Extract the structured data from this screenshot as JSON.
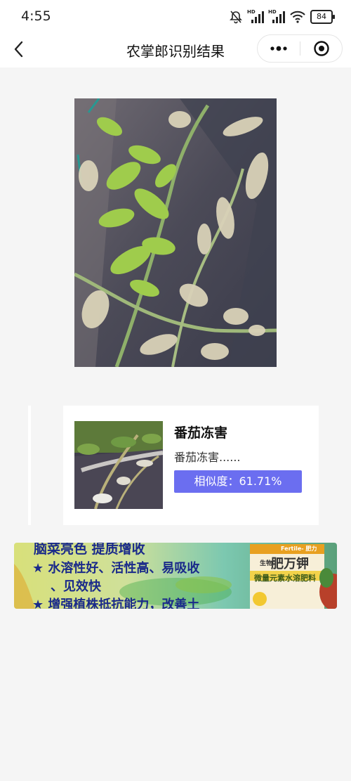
{
  "status": {
    "time": "4:55",
    "signal1_label": "HD",
    "signal2_label": "HD",
    "battery": "84",
    "icons": [
      "mute-bell-icon",
      "signal-icon",
      "signal-icon",
      "wifi-icon",
      "battery-icon"
    ]
  },
  "nav": {
    "title": "农掌郎识别结果",
    "back_icon": "chevron-left-icon",
    "more_icon": "more-dots-icon",
    "target_icon": "target-circle-icon"
  },
  "result": {
    "name": "番茄冻害",
    "description": "番茄冻害......",
    "similarity": "相似度：61.71%",
    "accent_color": "#6b6ef0"
  },
  "ad": {
    "line1": "脑菜亮色  提质增收",
    "line2": "★ 水溶性好、活性高、易吸收",
    "line3": "、见效快",
    "line4": "★ 增强植株抵抗能力，改善土",
    "brand_small": "Fertile- 肥力",
    "brand": "肥万钾",
    "brand_prefix": "生物",
    "product": "微量元素水溶肥料"
  }
}
